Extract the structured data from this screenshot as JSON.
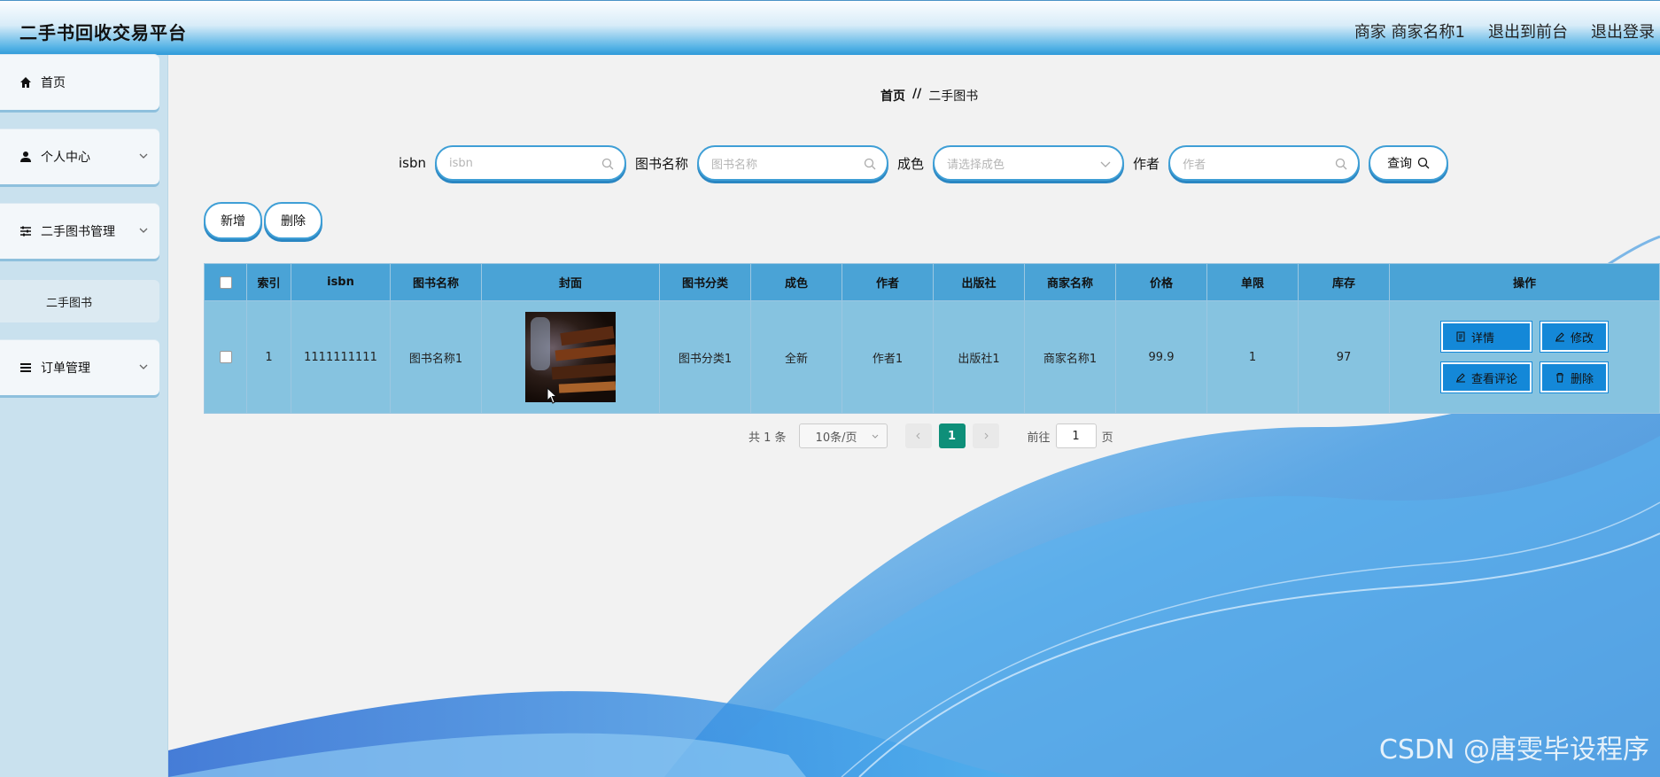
{
  "app": {
    "title": "二手书回收交易平台"
  },
  "header": {
    "user_label": "商家 商家名称1",
    "to_front": "退出到前台",
    "logout": "退出登录"
  },
  "sidebar": {
    "items": [
      {
        "label": "首页",
        "icon": "home-icon"
      },
      {
        "label": "个人中心",
        "icon": "user-icon"
      },
      {
        "label": "二手图书管理",
        "icon": "sliders-icon"
      },
      {
        "label": "订单管理",
        "icon": "list-icon"
      }
    ],
    "sub_item": "二手图书"
  },
  "breadcrumb": {
    "home": "首页",
    "sep": "//",
    "current": "二手图书"
  },
  "search": {
    "isbn_label": "isbn",
    "isbn_placeholder": "isbn",
    "name_label": "图书名称",
    "name_placeholder": "图书名称",
    "cond_label": "成色",
    "cond_placeholder": "请选择成色",
    "author_label": "作者",
    "author_placeholder": "作者",
    "query_label": "查询"
  },
  "actions": {
    "add": "新增",
    "delete": "删除"
  },
  "table": {
    "headers": [
      "索引",
      "isbn",
      "图书名称",
      "封面",
      "图书分类",
      "成色",
      "作者",
      "出版社",
      "商家名称",
      "价格",
      "单限",
      "库存",
      "操作"
    ],
    "row": {
      "index": "1",
      "isbn": "1111111111",
      "name": "图书名称1",
      "category": "图书分类1",
      "condition": "全新",
      "author": "作者1",
      "publisher": "出版社1",
      "merchant": "商家名称1",
      "price": "99.9",
      "limit": "1",
      "stock": "97"
    },
    "ops": {
      "detail": "详情",
      "edit": "修改",
      "comments": "查看评论",
      "delete": "删除"
    }
  },
  "pager": {
    "total": "共 1 条",
    "size": "10条/页",
    "page": "1",
    "goto": "前往",
    "goto_val": "1",
    "unit": "页"
  },
  "watermark": "CSDN @唐雯毕设程序",
  "colors": {
    "accent": "#3f9fd6",
    "header_row": "#4aa3d6",
    "body_row": "#86c3e0",
    "op_button": "#1488d8",
    "pager_active": "#0e8f79"
  }
}
